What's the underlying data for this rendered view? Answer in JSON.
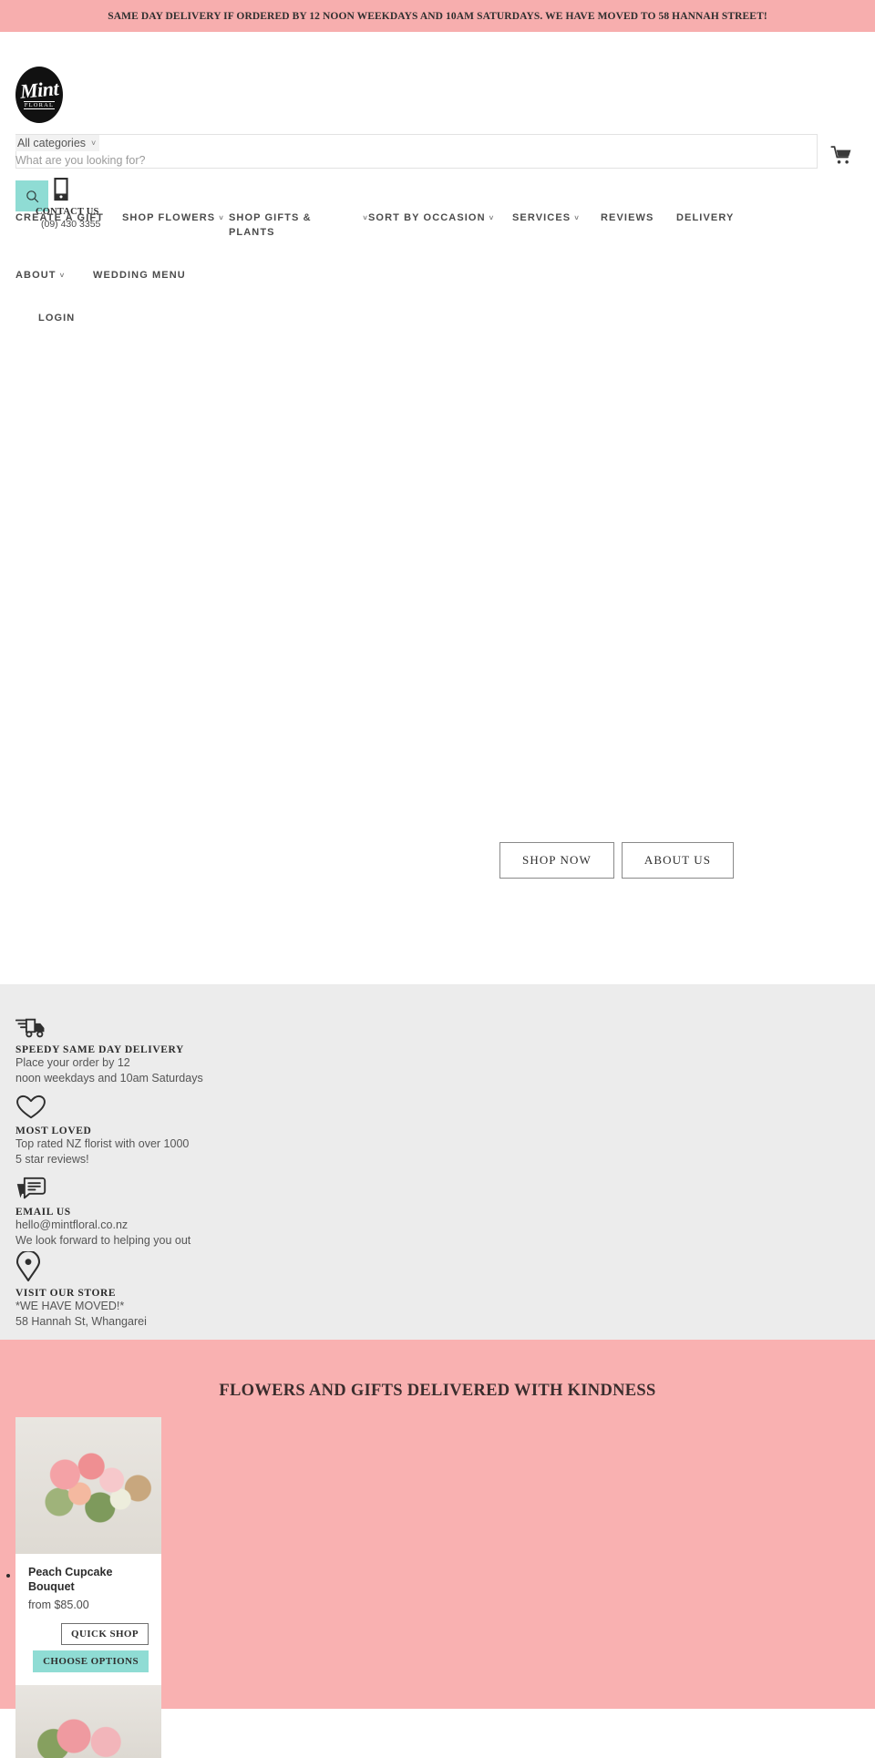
{
  "announcement": {
    "text": "SAME DAY DELIVERY IF ORDERED BY 12 NOON WEEKDAYS AND 10AM SATURDAYS. WE HAVE MOVED TO 58 HANNAH STREET!",
    "background": "#f7aeae"
  },
  "header": {
    "logo": {
      "main": "Mint",
      "sub": "FLORAL"
    },
    "category_select": {
      "value": "All categories",
      "chevron": "chevron-down-icon"
    },
    "search": {
      "placeholder": "What are you looking for?",
      "value": ""
    },
    "search_button": {
      "icon": "search-icon",
      "background": "#8fdcd4"
    },
    "contact": {
      "title": "CONTACT US",
      "phone": "(09) 430 3355",
      "icon": "phone-icon"
    },
    "cart": {
      "icon": "shopping-cart-icon"
    }
  },
  "nav": {
    "row1": [
      {
        "label": "CREATE A GIFT",
        "has_chevron": false
      },
      {
        "label": "SHOP FLOWERS",
        "has_chevron": true
      },
      {
        "label": "SHOP GIFTS & PLANTS",
        "has_chevron": true
      },
      {
        "label": "SORT BY OCCASION",
        "has_chevron": true
      },
      {
        "label": "SERVICES",
        "has_chevron": true
      },
      {
        "label": "REVIEWS",
        "has_chevron": false
      },
      {
        "label": "DELIVERY",
        "has_chevron": false
      }
    ],
    "row2": [
      {
        "label": "ABOUT",
        "has_chevron": true
      },
      {
        "label": "WEDDING MENU",
        "has_chevron": false
      }
    ],
    "row3": [
      {
        "label": "LOGIN",
        "has_chevron": false
      }
    ]
  },
  "hero": {
    "buttons": [
      {
        "label": "SHOP NOW"
      },
      {
        "label": "ABOUT US"
      }
    ]
  },
  "benefits": {
    "background": "#ececec",
    "items": [
      {
        "icon": "delivery-truck-icon",
        "title": "SPEEDY SAME DAY DELIVERY",
        "line1": "Place your order by 12",
        "line2": "noon weekdays and 10am Saturdays"
      },
      {
        "icon": "heart-icon",
        "title": "MOST LOVED",
        "line1": "Top rated NZ florist with over 1000",
        "line2": "5 star reviews!"
      },
      {
        "icon": "chat-bubble-icon",
        "title": "EMAIL US",
        "line1": "hello@mintfloral.co.nz",
        "line2": "We look forward to helping you out"
      },
      {
        "icon": "map-pin-icon",
        "title": "VISIT OUR STORE",
        "line1": "*WE HAVE MOVED!*",
        "line2": "58 Hannah St, Whangarei"
      }
    ]
  },
  "products": {
    "background": "#f9b1b1",
    "heading": "FLOWERS AND GIFTS DELIVERED WITH KINDNESS",
    "items": [
      {
        "title": "Peach Cupcake Bouquet",
        "price": "from $85.00",
        "quick_shop_label": "QUICK SHOP",
        "choose_options_label": "CHOOSE OPTIONS",
        "image_alt": "peach and pink flower bouquet on white wooden boards"
      }
    ]
  },
  "colors": {
    "pink_banner": "#f7aeae",
    "pink_section": "#f9b1b1",
    "mint_accent": "#8fdcd4",
    "grey_section": "#ececec"
  }
}
